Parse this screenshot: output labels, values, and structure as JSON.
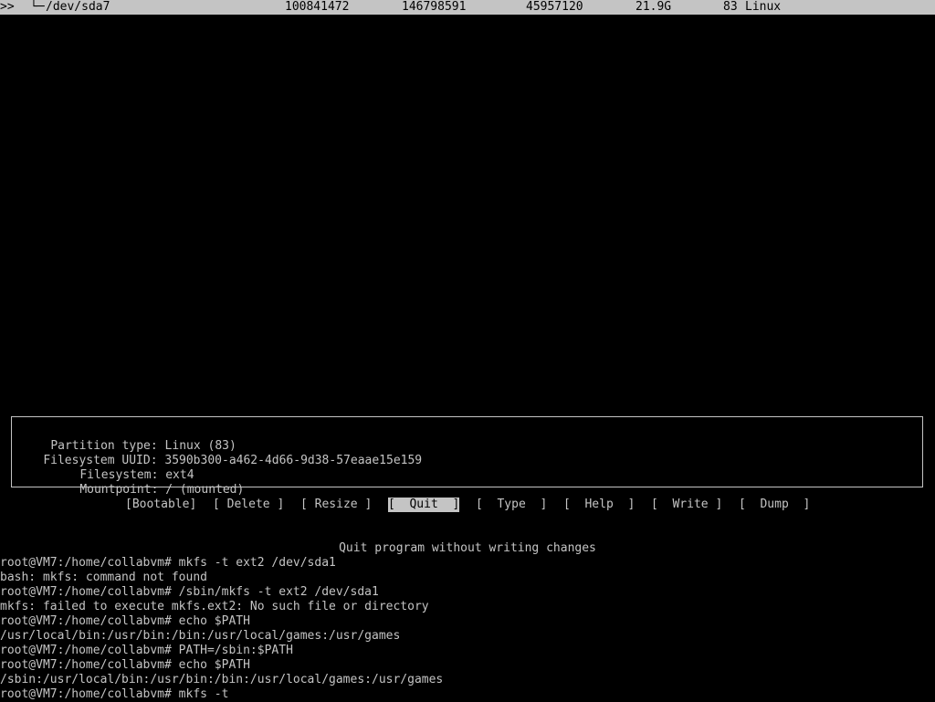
{
  "partition_row": {
    "prefix": ">>",
    "tree": "└─",
    "device": "/dev/sda7",
    "start": "100841472",
    "end": "146798591",
    "sectors": "45957120",
    "size": "21.9G",
    "id": "83",
    "type": "Linux"
  },
  "info": {
    "partition_type_label": "Partition type:",
    "partition_type_value": "Linux (83)",
    "uuid_label": "Filesystem UUID:",
    "uuid_value": "3590b300-a462-4d66-9d38-57eaae15e159",
    "filesystem_label": "Filesystem:",
    "filesystem_value": "ext4",
    "mountpoint_label": "Mountpoint:",
    "mountpoint_value": "/ (mounted)"
  },
  "menu": {
    "bootable": "[Bootable]",
    "delete": "[ Delete ]",
    "resize": "[ Resize ]",
    "quit": "[  Quit  ]",
    "type": "[  Type  ]",
    "help": "[  Help  ]",
    "write": "[  Write ]",
    "dump": "[  Dump  ]",
    "selected": "quit"
  },
  "hint": "Quit program without writing changes",
  "terminal": [
    "root@VM7:/home/collabvm# mkfs -t ext2 /dev/sda1",
    "bash: mkfs: command not found",
    "root@VM7:/home/collabvm# /sbin/mkfs -t ext2 /dev/sda1",
    "mkfs: failed to execute mkfs.ext2: No such file or directory",
    "root@VM7:/home/collabvm# echo $PATH",
    "/usr/local/bin:/usr/bin:/bin:/usr/local/games:/usr/games",
    "root@VM7:/home/collabvm# PATH=/sbin:$PATH",
    "root@VM7:/home/collabvm# echo $PATH",
    "/sbin:/usr/local/bin:/usr/bin:/bin:/usr/local/games:/usr/games",
    "root@VM7:/home/collabvm# mkfs -t"
  ]
}
